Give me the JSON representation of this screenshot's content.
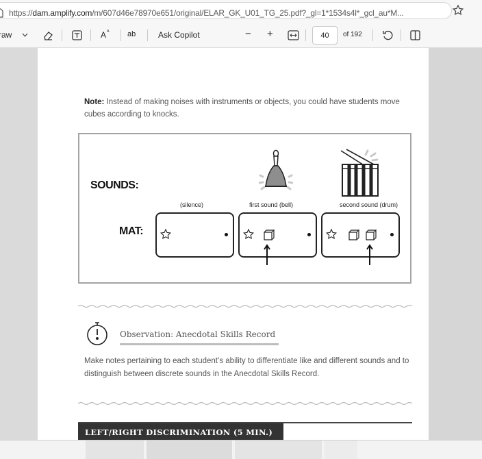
{
  "address_bar": {
    "url_prefix": "https://",
    "url_domain": "dam.amplify.com",
    "url_rest": "/m/607d46e78970e651/original/ELAR_GK_U01_TG_25.pdf?_gl=1*1534s4l*_gcl_au*M..."
  },
  "toolbar": {
    "draw_label": "raw",
    "aa_label": "A",
    "ab_label": "ab",
    "ask_copilot_label": "Ask Copilot",
    "zoom_out": "−",
    "zoom_in": "+",
    "current_page": "40",
    "page_total": "of 192"
  },
  "document": {
    "note_bold": "Note:",
    "note_text": " Instead of making noises with instruments or objects, you could have students move cubes according to knocks.",
    "diagram": {
      "sounds_label": "SOUNDS:",
      "mat_label": "MAT:",
      "captions": [
        "(silence)",
        "first sound (bell)",
        "second sound (drum)"
      ]
    },
    "observation_title": "Observation: Anecdotal Skills Record",
    "observation_text": "Make notes pertaining to each student’s ability to differentiate like and different sounds and to distinguish between discrete sounds in the Anecdotal Skills Record.",
    "section_heading": "LEFT/RIGHT DISCRIMINATION (5 MIN.)"
  },
  "colors": {
    "page_bg": "#ffffff",
    "viewer_bg": "#d9d9d9",
    "section_heading_bg": "#333333"
  }
}
